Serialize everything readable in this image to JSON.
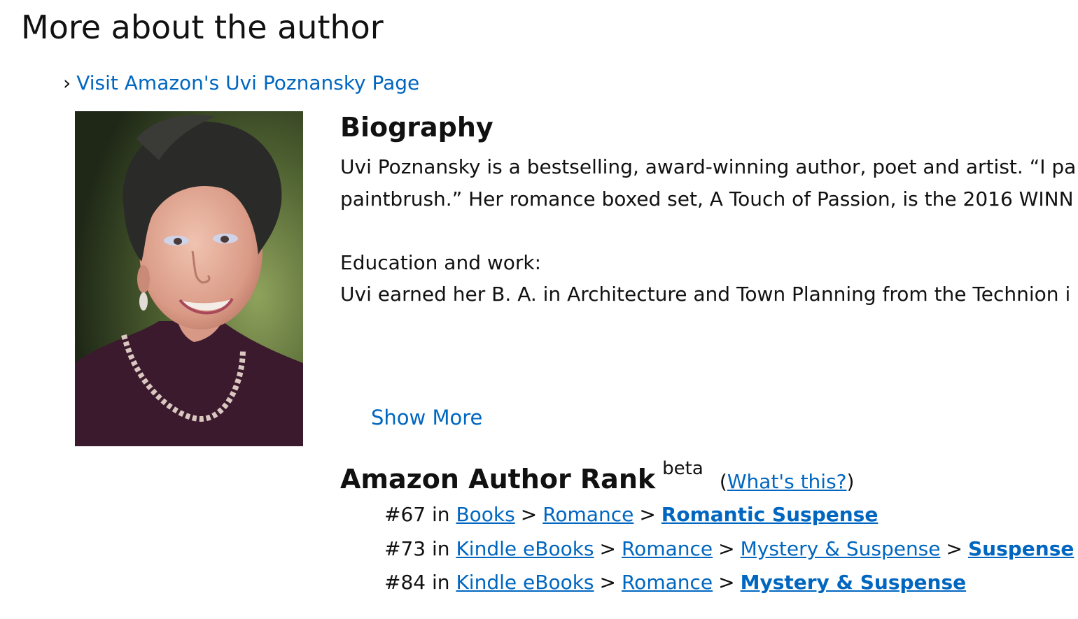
{
  "section_title": "More about the author",
  "visit_link": {
    "chevron": "›",
    "label": "Visit Amazon's Uvi Poznansky Page"
  },
  "author_photo": {
    "icon": "author-photo"
  },
  "biography": {
    "title": "Biography",
    "lines": [
      "Uvi Poznansky is a bestselling, award-winning author, poet and artist. “I pa",
      "paintbrush.” Her romance boxed set, A Touch of Passion, is the 2016 WINN",
      "",
      "Education and work:",
      "Uvi earned her B. A. in Architecture and Town Planning from the Technion i"
    ],
    "show_more": "Show More"
  },
  "author_rank": {
    "title": "Amazon Author Rank",
    "beta": "beta",
    "whats_this": "What's this?",
    "ranks": [
      {
        "rank": "#67",
        "in": "in",
        "path": [
          "Books",
          "Romance"
        ],
        "final": "Romantic Suspense"
      },
      {
        "rank": "#73",
        "in": "in",
        "path": [
          "Kindle eBooks",
          "Romance",
          "Mystery & Suspense"
        ],
        "final": "Suspense"
      },
      {
        "rank": "#84",
        "in": "in",
        "path": [
          "Kindle eBooks",
          "Romance"
        ],
        "final": "Mystery & Suspense"
      }
    ],
    "separator": ">"
  },
  "colors": {
    "link": "#0066c0",
    "text": "#111111"
  }
}
